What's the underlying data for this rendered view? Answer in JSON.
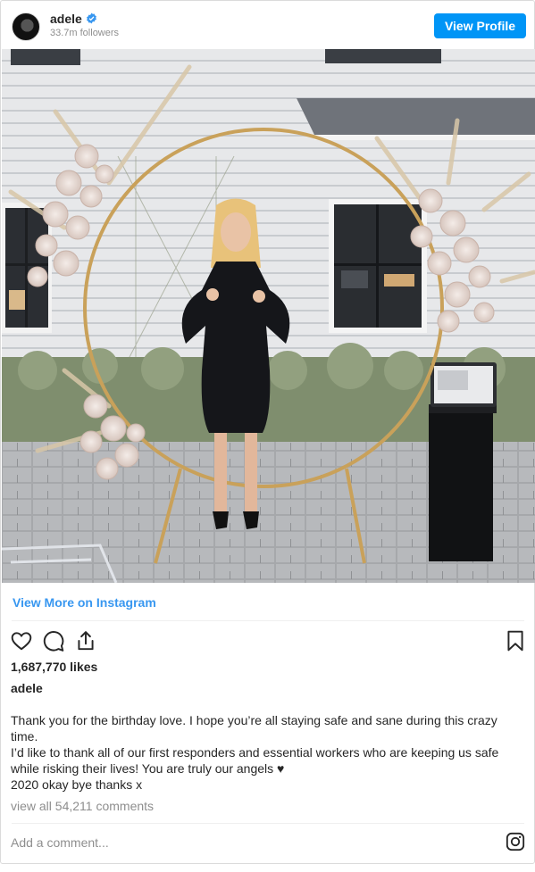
{
  "header": {
    "username": "adele",
    "followers": "33.7m followers",
    "view_profile_label": "View Profile"
  },
  "post": {
    "view_more_label": "View More on Instagram",
    "likes": "1,687,770 likes",
    "caption_username": "adele",
    "caption_lines": [
      "Thank you for the birthday love. I hope you’re all staying safe and sane during this crazy time.",
      "I’d like to thank all of our first responders and essential workers who are keeping us safe while risking their lives! You are truly our angels ♥",
      "2020 okay bye thanks x"
    ],
    "comments_label": "view all 54,211 comments",
    "add_comment_placeholder": "Add a comment..."
  },
  "icons": [
    "heart-icon",
    "comment-icon",
    "share-icon",
    "bookmark-icon",
    "instagram-logo-icon",
    "verified-badge-icon"
  ],
  "colors": {
    "accent": "#0095f6",
    "link": "#3897f0",
    "muted": "#8e8e8e"
  }
}
